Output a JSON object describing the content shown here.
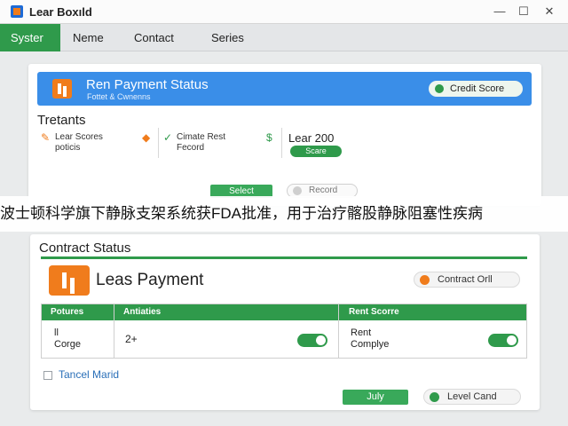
{
  "window": {
    "title": "Lear Boxıld",
    "controls": {
      "minimize": "—",
      "maximize": "☐",
      "close": "✕"
    }
  },
  "menu": {
    "items": [
      {
        "label": "Syster",
        "active": true
      },
      {
        "label": "Neme",
        "active": false
      },
      {
        "label": "Contact",
        "active": false
      },
      {
        "label": "Series",
        "active": false
      }
    ]
  },
  "status_card": {
    "title": "Ren Payment Status",
    "subtitle": "Fottet & Cwnenns",
    "credit_label": "Credit Score",
    "section_title": "Tretants",
    "items": [
      {
        "icon": "pencil-icon",
        "line1": "Lear Scores",
        "line2": "poticis"
      },
      {
        "icon": "check-icon",
        "line1": "Cimate Rest",
        "line2": "Fecord"
      }
    ],
    "lear_value": "Lear 200",
    "score_label": "Scare",
    "select_label": "Select",
    "record_label": "Record"
  },
  "overlay_caption": "波士顿科学旗下静脉支架系统获FDA批准，用于治疗髂股静脉阻塞性疾病",
  "contract": {
    "section_title": "Contract Status",
    "lease_title": "Leas Payment",
    "contract_pill": "Contract Orll",
    "table": {
      "headers": [
        "Potures",
        "Antiaties",
        "Rent Scorre"
      ],
      "row": {
        "col1_line1": "ll",
        "col1_line2": "Corge",
        "col2": "2+",
        "col3_line1": "Rent",
        "col3_line2": "Complye"
      }
    },
    "checkbox_label": "Tancel Marid",
    "july_label": "July",
    "level_label": "Level Cand"
  },
  "colors": {
    "accent_green": "#2f9a4b",
    "banner_blue": "#3a8ee8",
    "icon_orange": "#f07c1c"
  }
}
